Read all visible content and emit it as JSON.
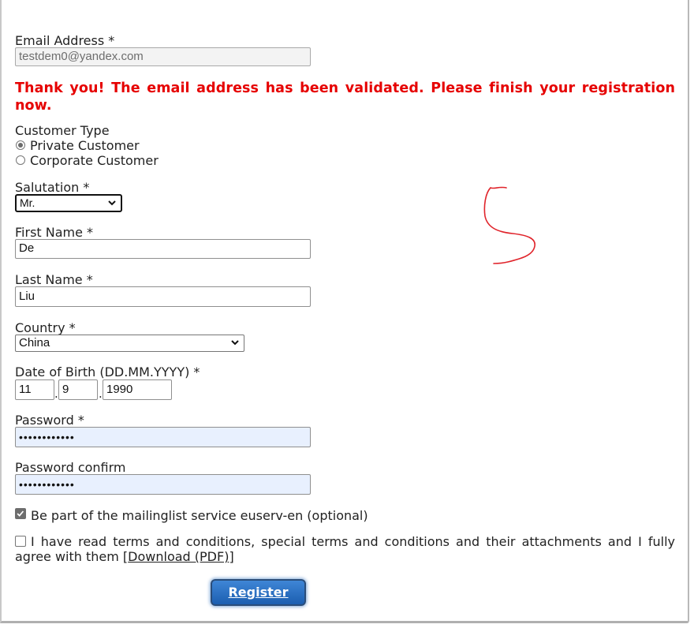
{
  "email": {
    "label": "Email Address *",
    "value": "testdem0@yandex.com"
  },
  "validation_message": "Thank you! The email address has been validated. Please finish your registration now.",
  "customer_type": {
    "label": "Customer Type",
    "options": [
      "Private Customer",
      "Corporate Customer"
    ],
    "selected": "Private Customer"
  },
  "salutation": {
    "label": "Salutation *",
    "value": "Mr."
  },
  "first_name": {
    "label": "First Name *",
    "value": "De"
  },
  "last_name": {
    "label": "Last Name *",
    "value": "Liu"
  },
  "country": {
    "label": "Country *",
    "value": "China"
  },
  "dob": {
    "label": "Date of Birth (DD.MM.YYYY) *",
    "day": "11",
    "month": "9",
    "year": "1990",
    "separator": "."
  },
  "password": {
    "label": "Password *",
    "masked": "••••••••••••"
  },
  "password_confirm": {
    "label": "Password confirm",
    "masked": "••••••••••••"
  },
  "mailinglist": {
    "label": "Be part of the mailinglist service euserv-en (optional)",
    "checked": true
  },
  "terms": {
    "text": "I have read terms and conditions, special terms and conditions and their attachments and I fully agree with them [",
    "link": "Download (PDF)",
    "suffix": "]",
    "checked": false
  },
  "register_label": "Register",
  "colors": {
    "error": "#e60000",
    "button": "#2f6fbf",
    "autofill": "#e8f0fe",
    "annotation": "#e0242b"
  }
}
